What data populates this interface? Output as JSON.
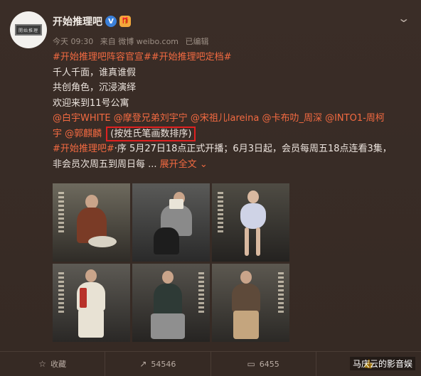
{
  "user": {
    "name": "开始推理吧",
    "avatar_text": "開始推理",
    "verified_glyph": "V",
    "badge_glyph": "🎁"
  },
  "meta": {
    "time": "今天 09:30",
    "source": "来自 微博 weibo.com",
    "edited": "已编辑"
  },
  "post": {
    "tags_line": "#开始推理吧阵容官宣##开始推理吧定档#",
    "line1": "千人千面，谁真谁假",
    "line2": "共创角色，沉浸演绎",
    "line3": "欢迎来到11号公寓",
    "mentions_1": "@白宇WHITE @摩登兄弟刘宇宁 @宋祖儿lareina @卡布叻_周深 @INTO1-周柯",
    "mentions_2a": "宇 @郭麒麟 ",
    "boxed_note": "(按姓氏笔画数排序)",
    "line_tag": "#开始推理吧#",
    "line_rest": "·序 5月27日18点正式开播；6月3日起，会员每周五18点连看3集，",
    "line_last": "非会员次周五到周日每 ... ",
    "expand": "展开全文"
  },
  "footer": {
    "collect_label": "收藏",
    "share_count": "54546",
    "comment_count": "6455"
  },
  "watermark": "马庆云的影音娱",
  "icons": [
    "chevron-down-icon",
    "star-icon",
    "share-icon",
    "comment-icon",
    "like-icon"
  ]
}
